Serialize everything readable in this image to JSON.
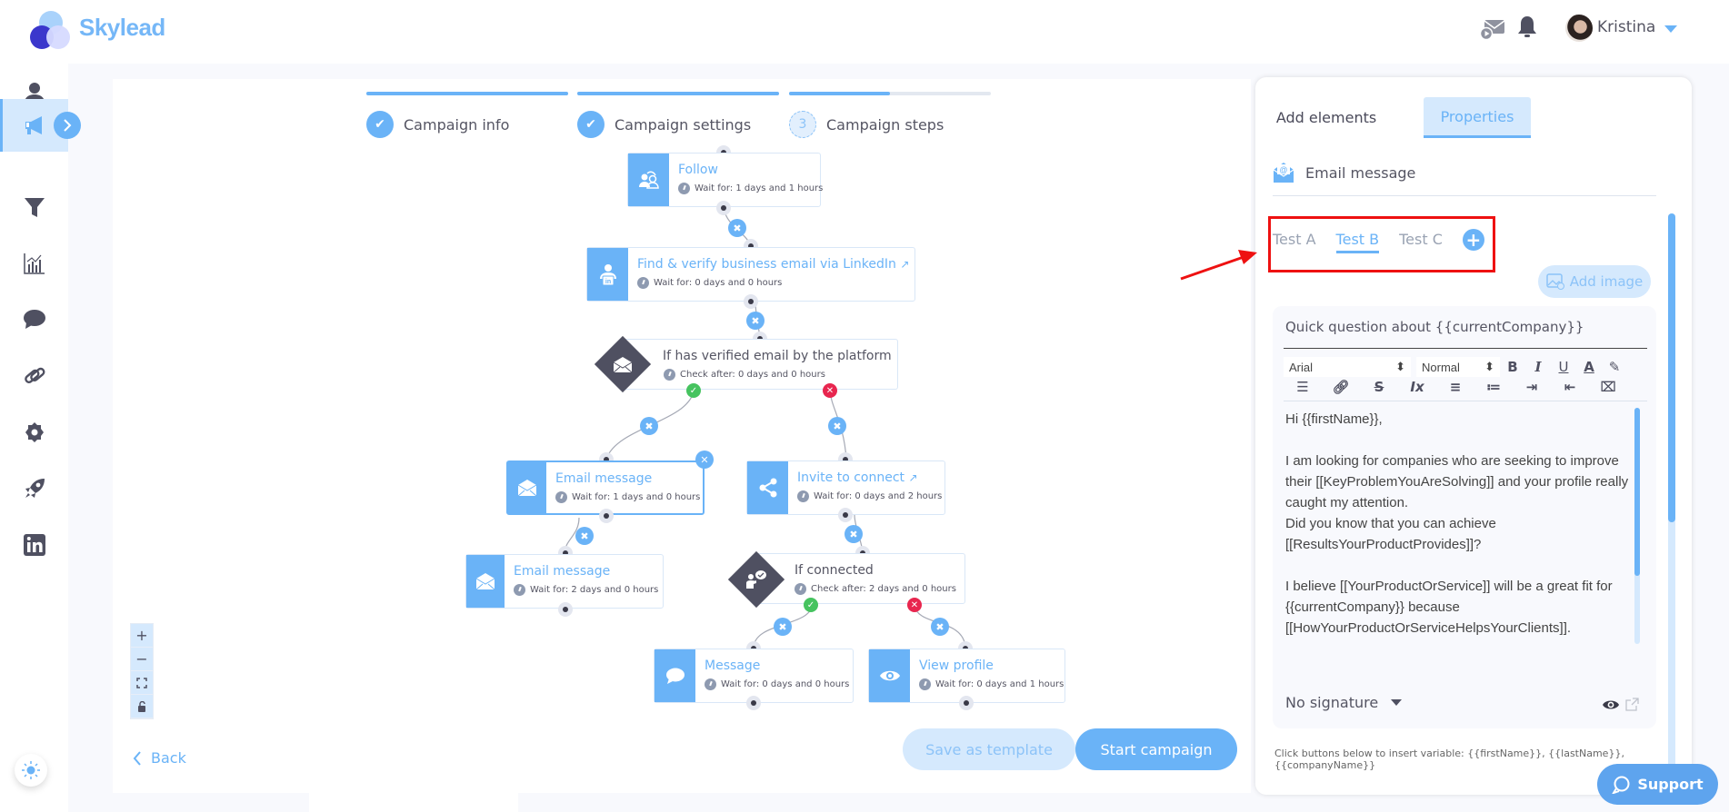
{
  "app": {
    "brand": "Skylead"
  },
  "header": {
    "user_name": "Kristina",
    "icons": [
      "mail-play-icon",
      "bell-icon",
      "avatar",
      "chevron-down-icon"
    ]
  },
  "sidebar": {
    "items": [
      {
        "name": "contacts",
        "icon": "user-icon"
      },
      {
        "name": "campaigns",
        "icon": "megaphone-icon",
        "active": true
      },
      {
        "name": "filters",
        "icon": "funnel-icon"
      },
      {
        "name": "statistics",
        "icon": "chart-icon"
      },
      {
        "name": "inbox",
        "icon": "chat-icon"
      },
      {
        "name": "integrations",
        "icon": "link-icon"
      },
      {
        "name": "settings",
        "icon": "gear-icon"
      },
      {
        "name": "boost",
        "icon": "rocket-icon"
      },
      {
        "name": "linkedin",
        "icon": "linkedin-icon"
      }
    ]
  },
  "wizard": {
    "steps": [
      {
        "label": "Campaign info",
        "status": "done",
        "progress": 1.0
      },
      {
        "label": "Campaign settings",
        "status": "done",
        "progress": 1.0
      },
      {
        "label": "Campaign steps",
        "status": "current",
        "number": "3",
        "progress": 0.5
      }
    ]
  },
  "flow": {
    "nodes": [
      {
        "id": "follow",
        "type": "action",
        "title": "Follow",
        "sub": "Wait for: 1 days and 1 hours",
        "icon": "follow-icon"
      },
      {
        "id": "find-email",
        "type": "action",
        "title": "Find & verify business email via LinkedIn",
        "sub": "Wait for: 0 days and 0 hours",
        "icon": "linkedin-user-icon",
        "external_link": true
      },
      {
        "id": "if-verified",
        "type": "condition",
        "title": "If has verified email by the platform",
        "sub": "Check after: 0 days and 0 hours",
        "icon": "envelope-open-icon"
      },
      {
        "id": "email-1",
        "type": "action",
        "title": "Email message",
        "sub": "Wait for: 1 days and 0 hours",
        "icon": "envelope-icon",
        "selected": true
      },
      {
        "id": "invite",
        "type": "action",
        "title": "Invite to connect",
        "sub": "Wait for: 0 days and 2 hours",
        "icon": "share-icon",
        "external_link": true
      },
      {
        "id": "email-2",
        "type": "action",
        "title": "Email message",
        "sub": "Wait for: 2 days and 0 hours",
        "icon": "envelope-icon"
      },
      {
        "id": "if-connected",
        "type": "condition",
        "title": "If connected",
        "sub": "Check after: 2 days and 0 hours",
        "icon": "person-chat-icon"
      },
      {
        "id": "message",
        "type": "action",
        "title": "Message",
        "sub": "Wait for: 0 days and 0 hours",
        "icon": "chat-bubble-icon"
      },
      {
        "id": "view-profile",
        "type": "action",
        "title": "View profile",
        "sub": "Wait for: 0 days and 1 hours",
        "icon": "eye-icon"
      }
    ],
    "zoom_controls": [
      "+",
      "−",
      "fit",
      "lock"
    ]
  },
  "footer": {
    "back_label": "Back",
    "save_template_label": "Save as template",
    "start_campaign_label": "Start campaign"
  },
  "panel": {
    "tabs": [
      {
        "label": "Add elements",
        "active": false
      },
      {
        "label": "Properties",
        "active": true
      }
    ],
    "element_title": "Email message",
    "ab_tests": [
      {
        "label": "Test A",
        "active": false
      },
      {
        "label": "Test B",
        "active": true
      },
      {
        "label": "Test C",
        "active": false
      }
    ],
    "add_image_label": "Add image",
    "subject": "Quick question about {{currentCompany}}",
    "toolbar": {
      "font": "Arial",
      "size": "Normal"
    },
    "body_lines": [
      "Hi {{firstName}},",
      "",
      "I am looking for companies who are seeking to improve their [[KeyProblemYouAreSolving]] and your profile really caught my attention.",
      "Did you know that you can achieve [[ResultsYourProductProvides]]?",
      "",
      "I believe [[YourProductOrService]] will be a great fit for {{currentCompany}} because [[HowYourProductOrServiceHelpsYourClients]]."
    ],
    "signature": "No signature",
    "hint": "Click buttons below to insert variable: {{firstName}}, {{lastName}}, {{companyName}}"
  },
  "support_label": "Support",
  "annotation": {
    "color": "#ee1111",
    "target": "A/B test tabs"
  }
}
